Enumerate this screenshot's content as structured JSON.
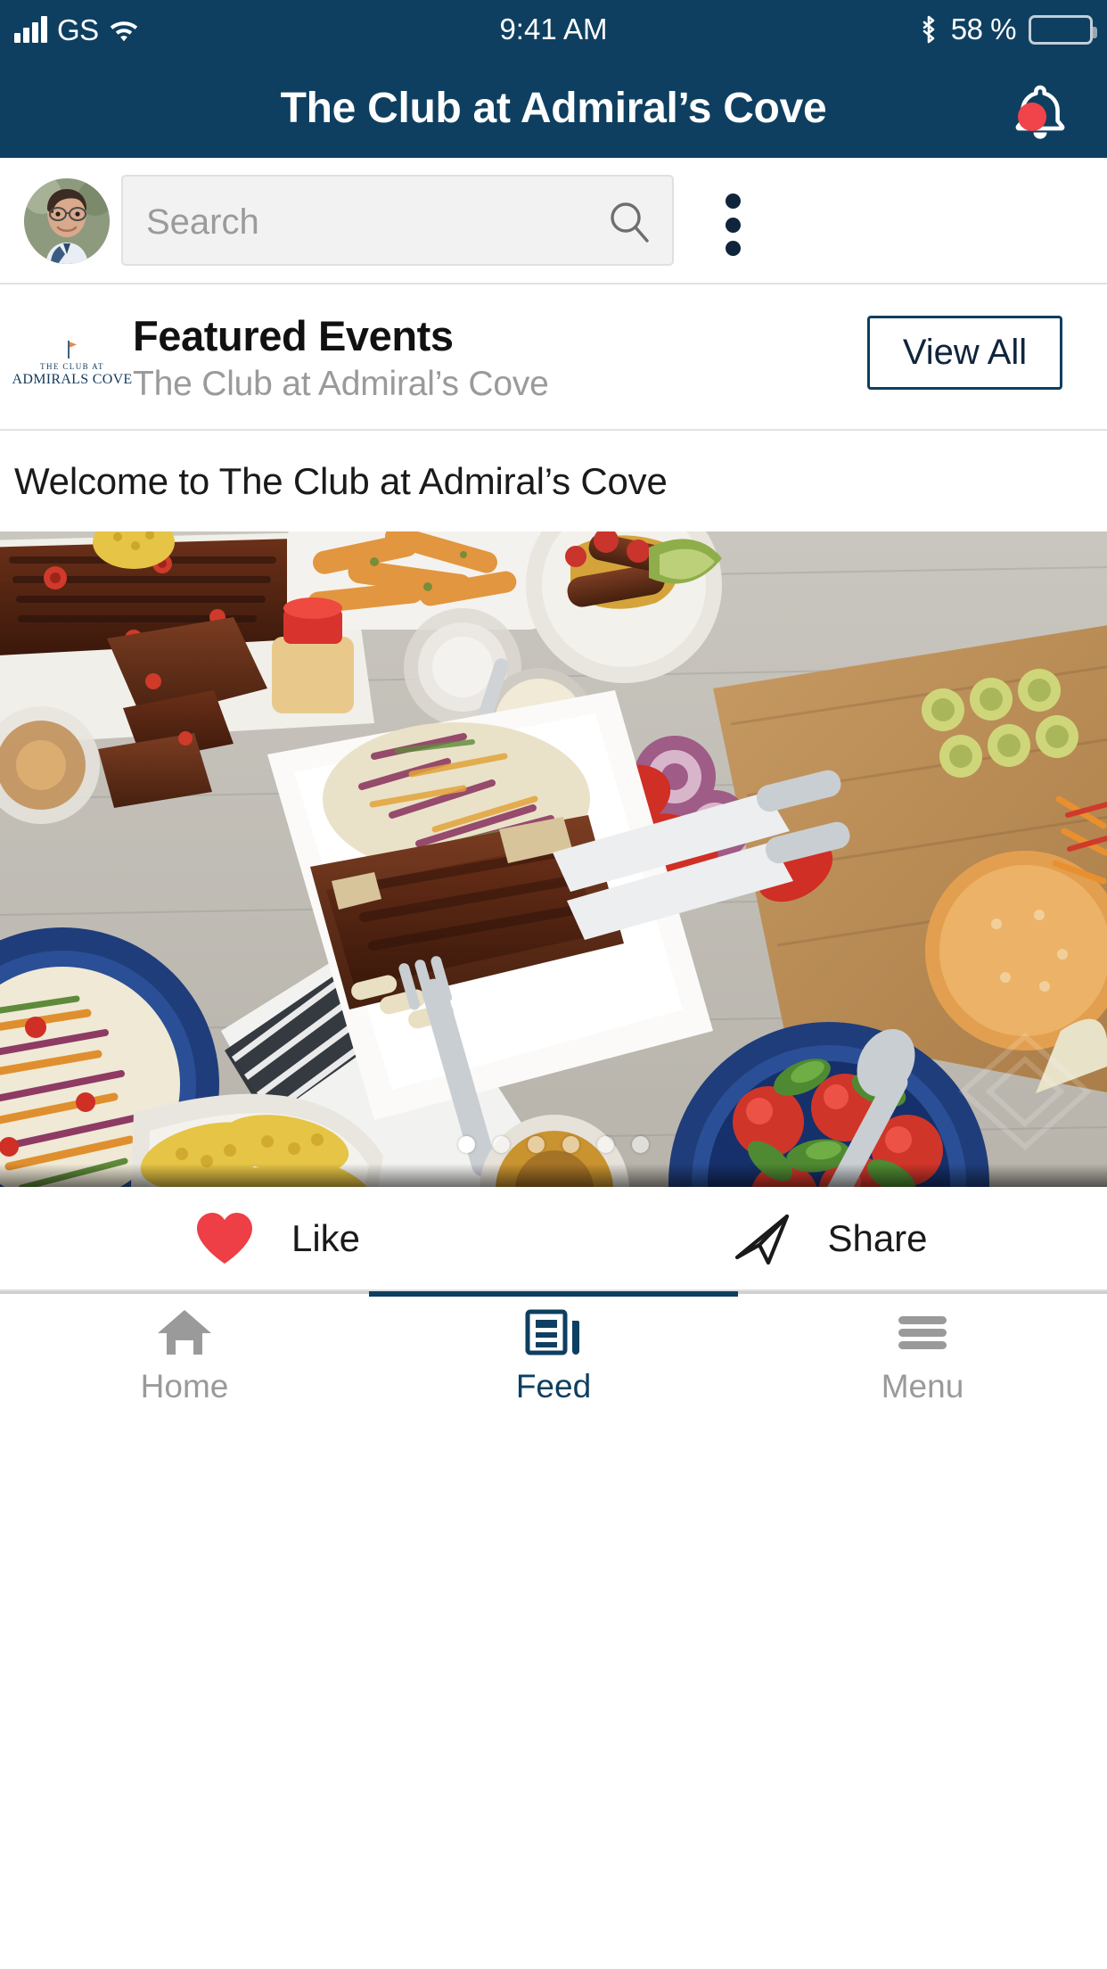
{
  "status_bar": {
    "carrier": "GS",
    "time": "9:41 AM",
    "battery_percent": "58 %",
    "icons": [
      "signal-bars-icon",
      "wifi-icon",
      "bluetooth-icon",
      "battery-icon"
    ]
  },
  "app_bar": {
    "title": "The Club at Admiral’s Cove",
    "notifications_icon": "bell-icon",
    "has_unread_badge": true,
    "background": "#0E3F60"
  },
  "search": {
    "placeholder": "Search",
    "value": "",
    "icon": "search-icon",
    "avatar": "user-avatar",
    "overflow_icon": "kebab-menu-icon"
  },
  "featured": {
    "logo_line1": "THE CLUB AT",
    "logo_line2": "ADMIRALS COVE",
    "title": "Featured Events",
    "subtitle": "The Club at Admiral’s Cove",
    "view_all_label": "View All"
  },
  "feed": {
    "welcome_text": "Welcome to The Club at Admiral’s Cove",
    "carousel": {
      "total_slides": 6,
      "active_slide": 1,
      "image_description": "Barbecue spread on a wooden table with ribs, slaw, corn, tomatoes and a burger"
    },
    "actions": [
      {
        "label": "Like",
        "icon": "heart-icon"
      },
      {
        "label": "Share",
        "icon": "paper-plane-icon"
      }
    ]
  },
  "tab_bar": {
    "items": [
      {
        "label": "Home",
        "icon": "home-icon",
        "active": false
      },
      {
        "label": "Feed",
        "icon": "newspaper-icon",
        "active": true
      },
      {
        "label": "Menu",
        "icon": "hamburger-icon",
        "active": false
      }
    ]
  },
  "colors": {
    "brand_navy": "#0E3F60",
    "accent_red": "#F1434A",
    "muted_gray": "#9a9a9a",
    "field_gray": "#f2f2f2"
  }
}
